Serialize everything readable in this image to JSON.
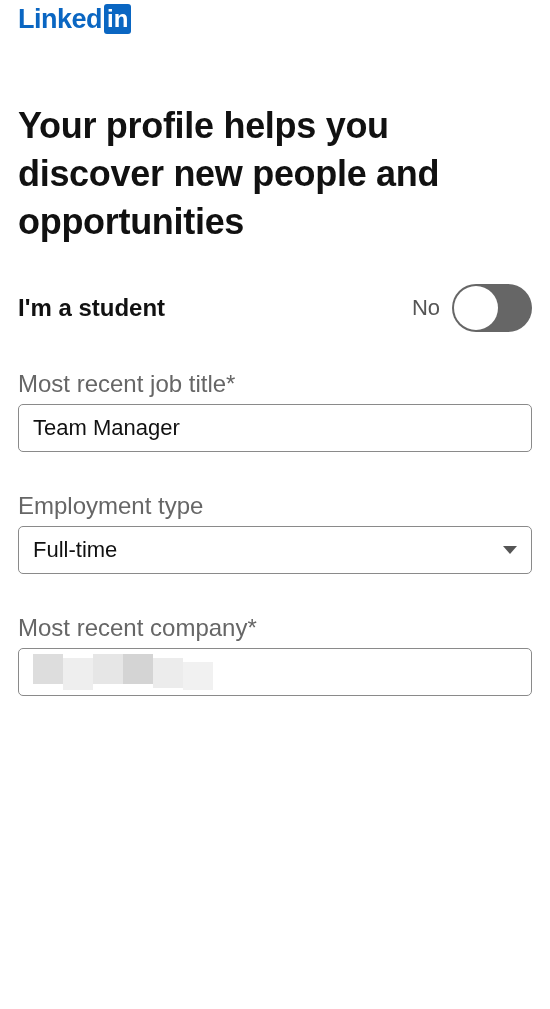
{
  "logo": {
    "text": "Linked",
    "badge": "in"
  },
  "heading": "Your profile helps you discover new people and opportunities",
  "student": {
    "label": "I'm a student",
    "state_text": "No",
    "on": false
  },
  "fields": [
    {
      "kind": "text",
      "label": "Most recent job title*",
      "value": "Team Manager"
    },
    {
      "kind": "select",
      "label": "Employment type",
      "value": "Full-time"
    },
    {
      "kind": "redacted",
      "label": "Most recent company*"
    }
  ]
}
